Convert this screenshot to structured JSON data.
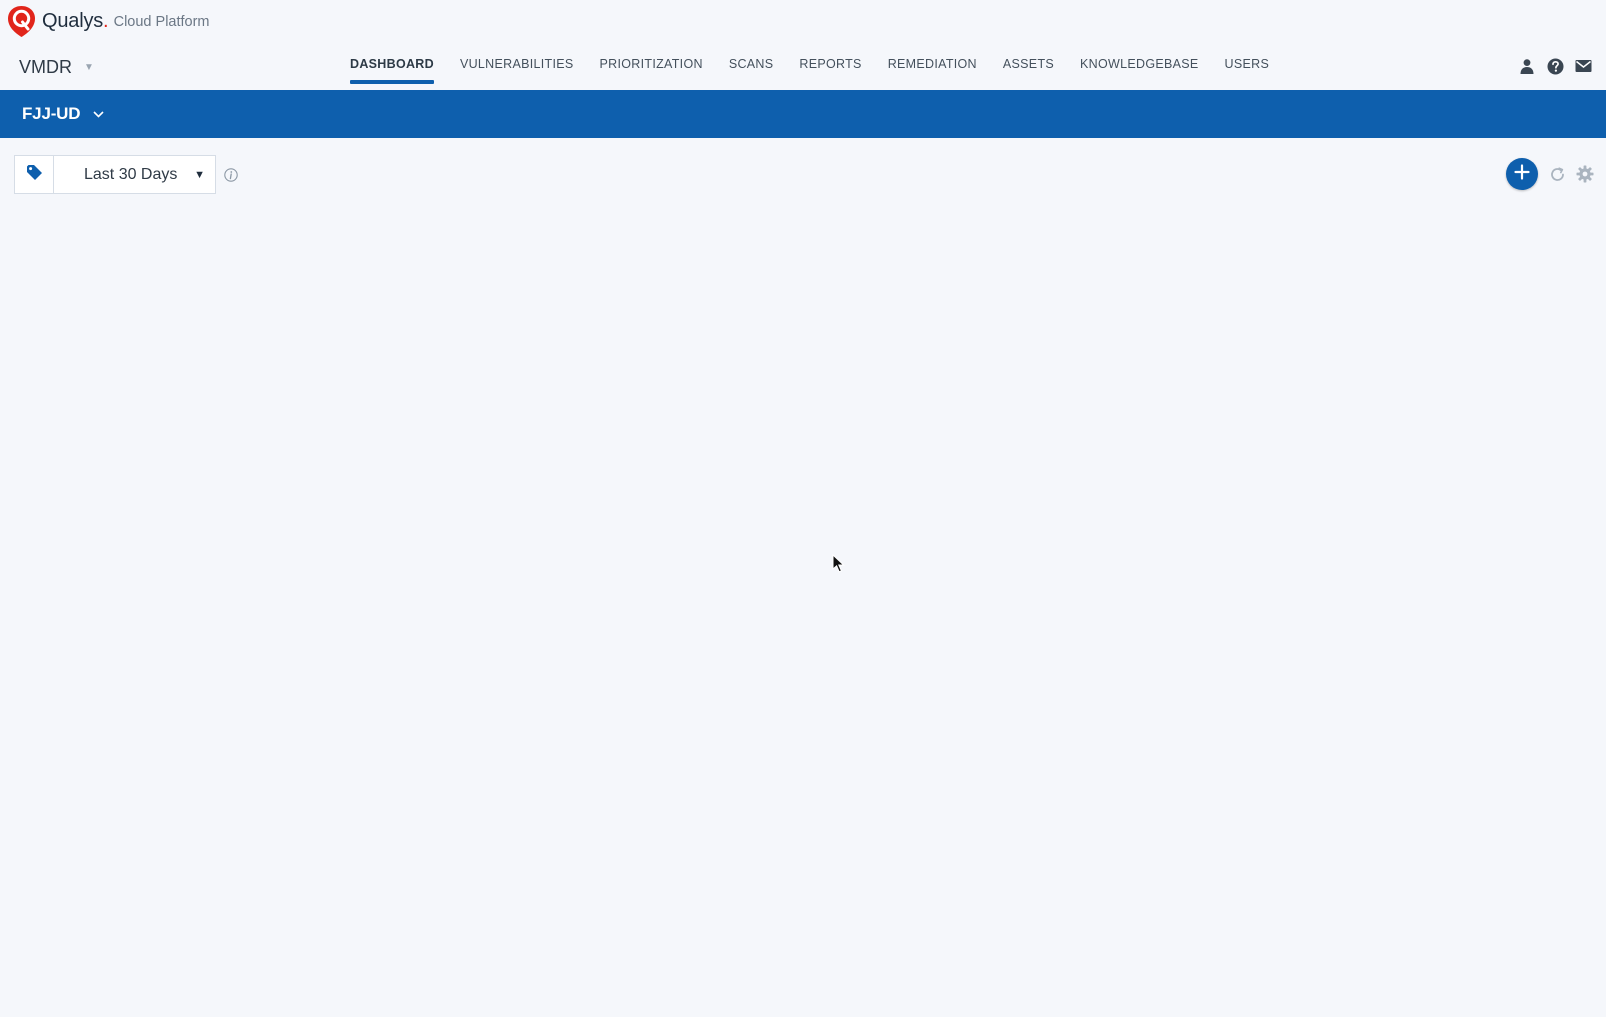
{
  "brand": {
    "name": "Qualys",
    "dot": ".",
    "suffix": "Cloud Platform",
    "logo_icon": "qualys-shield-logo",
    "colors": {
      "logo_red": "#e1251b",
      "accent_blue": "#0e5fad"
    }
  },
  "app_switcher": {
    "label": "VMDR",
    "icon": "caret-down-icon"
  },
  "nav": {
    "tabs": [
      {
        "label": "DASHBOARD",
        "active": true
      },
      {
        "label": "VULNERABILITIES",
        "active": false
      },
      {
        "label": "PRIORITIZATION",
        "active": false
      },
      {
        "label": "SCANS",
        "active": false
      },
      {
        "label": "REPORTS",
        "active": false
      },
      {
        "label": "REMEDIATION",
        "active": false
      },
      {
        "label": "ASSETS",
        "active": false
      },
      {
        "label": "KNOWLEDGEBASE",
        "active": false
      },
      {
        "label": "USERS",
        "active": false
      }
    ]
  },
  "header_icons": [
    "user-icon",
    "help-icon",
    "mail-icon"
  ],
  "dashboard": {
    "name": "FJJ-UD",
    "selector_icon": "chevron-down-icon"
  },
  "toolbar": {
    "tag_icon": "tag-icon",
    "time_range": "Last 30 Days",
    "info_icon": "info-icon",
    "right_icons": [
      "add-widget-icon",
      "refresh-icon",
      "settings-gear-icon"
    ]
  }
}
